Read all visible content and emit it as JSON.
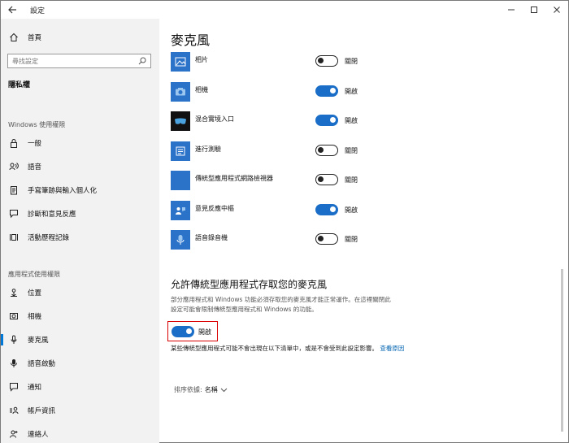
{
  "window": {
    "title": "設定",
    "controls": [
      "minimize",
      "maximize",
      "close"
    ]
  },
  "sidebar": {
    "home_label": "首頁",
    "search_placeholder": "尋找設定",
    "privacy_header": "隱私權",
    "windows_section": "Windows 使用權限",
    "windows_items": [
      {
        "label": "一般",
        "icon": "lock-icon"
      },
      {
        "label": "語音",
        "icon": "speech-icon"
      },
      {
        "label": "手寫筆跡與輸入個人化",
        "icon": "clipboard-icon"
      },
      {
        "label": "診斷和意見反應",
        "icon": "feedback-icon"
      },
      {
        "label": "活動歷程記錄",
        "icon": "timeline-icon"
      }
    ],
    "app_section": "應用程式使用權限",
    "app_items": [
      {
        "label": "位置",
        "icon": "location-icon"
      },
      {
        "label": "相機",
        "icon": "camera-icon"
      },
      {
        "label": "麥克風",
        "icon": "microphone-icon",
        "active": true
      },
      {
        "label": "語音啟動",
        "icon": "voice-activation-icon"
      },
      {
        "label": "通知",
        "icon": "notification-icon"
      },
      {
        "label": "帳戶資訊",
        "icon": "account-info-icon"
      },
      {
        "label": "連絡人",
        "icon": "contacts-icon"
      }
    ]
  },
  "main": {
    "title": "麥克風",
    "apps": [
      {
        "name": "相片",
        "state": "關閉",
        "on": false,
        "icon": "photos-icon"
      },
      {
        "name": "相機",
        "state": "開啟",
        "on": true,
        "icon": "camera-app-icon"
      },
      {
        "name": "混合實境入口",
        "state": "開啟",
        "on": true,
        "icon": "mixed-reality-icon"
      },
      {
        "name": "進行測驗",
        "state": "關閉",
        "on": false,
        "icon": "take-test-icon"
      },
      {
        "name": "傳統型應用程式網路檢視器",
        "state": "關閉",
        "on": false,
        "icon": "webview-icon"
      },
      {
        "name": "意見反應中樞",
        "state": "開啟",
        "on": true,
        "icon": "feedback-hub-icon"
      },
      {
        "name": "語音錄音機",
        "state": "關閉",
        "on": false,
        "icon": "voice-recorder-icon"
      }
    ],
    "desktop_section": {
      "title": "允許傳統型應用程式存取您的麥克風",
      "description": "部分應用程式和 Windows 功能必須存取您的麥克風才能正常運作。在這裡關閉此設定可能會限制傳統型應用程式和 Windows 的功能。",
      "toggle_label": "開啟",
      "toggle_on": true,
      "note": "某些傳統型應用程式可能不會出現在以下清單中，或是不會受到此設定影響。",
      "note_link": "查看原因"
    },
    "sort": {
      "label": "排序依據:",
      "value": "名稱"
    }
  },
  "colors": {
    "accent": "#1a6ec7",
    "tile": "#2b73c8",
    "sidebar_bg": "#f2f2f2",
    "highlight": "#d80000"
  }
}
